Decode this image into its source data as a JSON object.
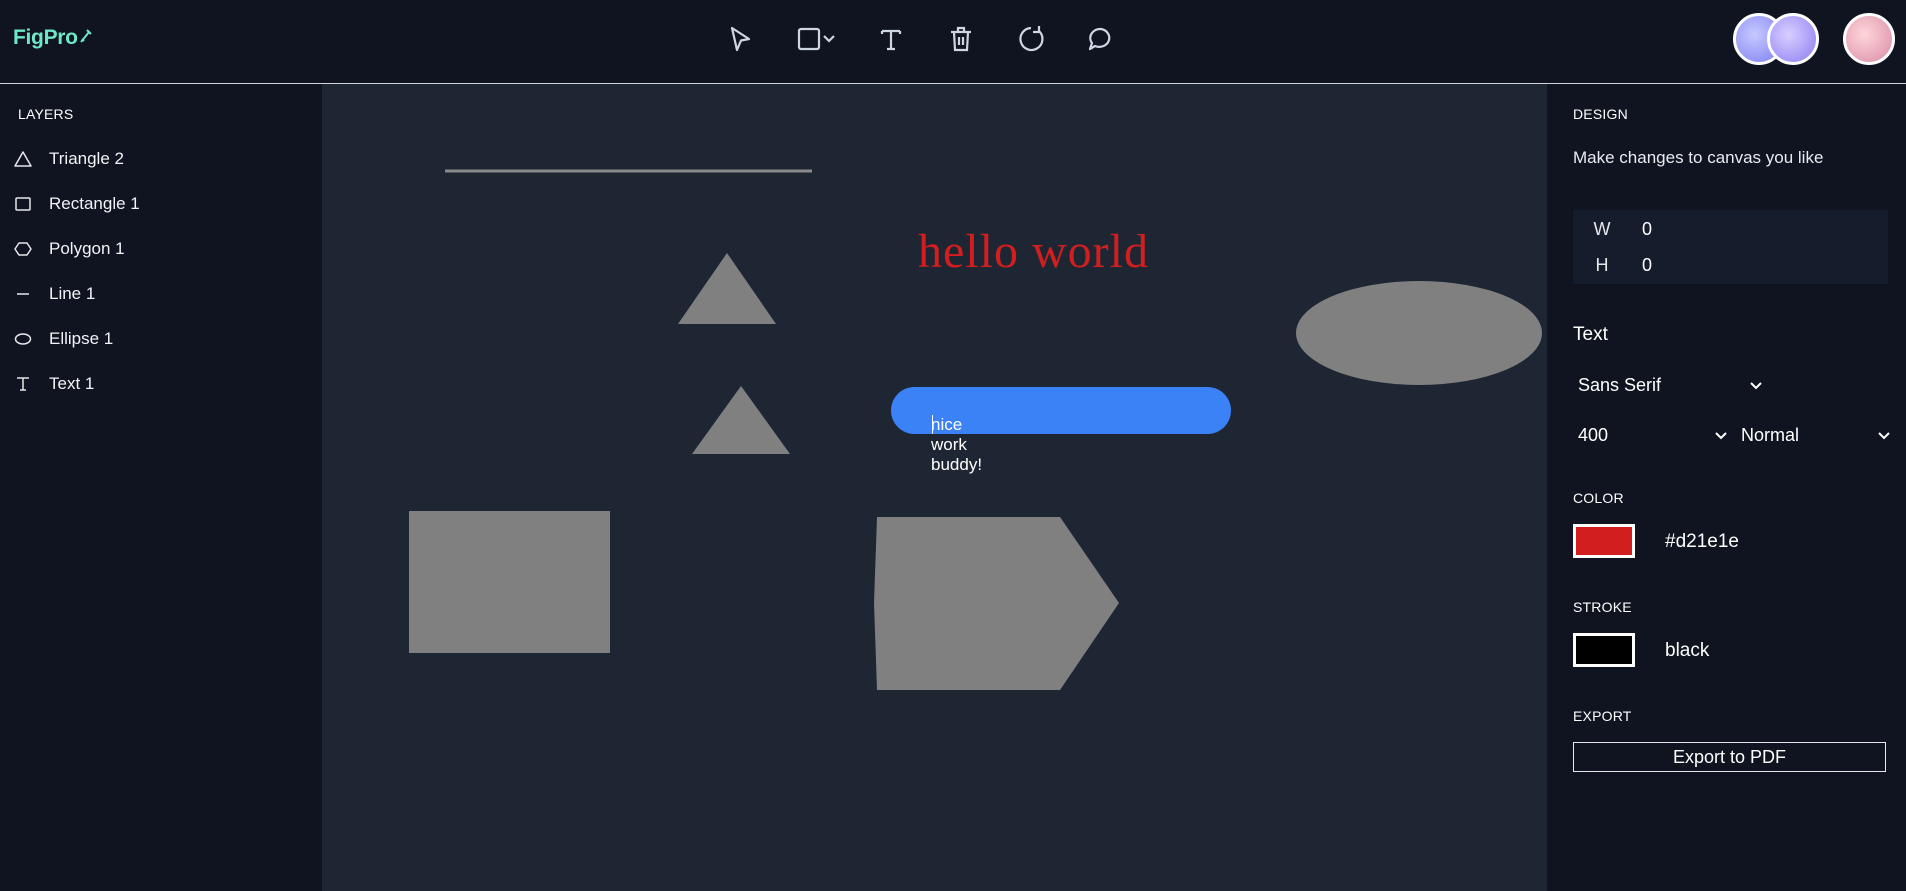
{
  "app": {
    "logo_text": "FigPro"
  },
  "toolbar": {
    "tools": [
      {
        "name": "select-tool",
        "icon": "cursor-arrow-icon"
      },
      {
        "name": "shape-tool",
        "icon": "square-icon"
      },
      {
        "name": "text-tool",
        "icon": "text-t-icon"
      },
      {
        "name": "delete-tool",
        "icon": "trash-icon"
      },
      {
        "name": "reset-tool",
        "icon": "rotate-icon"
      },
      {
        "name": "comment-tool",
        "icon": "speech-bubble-icon"
      }
    ]
  },
  "layers": {
    "title": "LAYERS",
    "items": [
      {
        "label": "Triangle 2",
        "icon": "triangle-icon"
      },
      {
        "label": "Rectangle 1",
        "icon": "rectangle-icon"
      },
      {
        "label": "Polygon 1",
        "icon": "hexagon-icon"
      },
      {
        "label": "Line 1",
        "icon": "line-icon"
      },
      {
        "label": "Ellipse 1",
        "icon": "ellipse-icon"
      },
      {
        "label": "Text 1",
        "icon": "text-t-icon"
      }
    ]
  },
  "canvas": {
    "heading_text": "hello world",
    "heading_color": "#d21e1e",
    "editing_text": "nice work  buddy!",
    "shape_color": "#808080",
    "background": "#1f2633"
  },
  "design": {
    "title": "DESIGN",
    "subtitle": "Make changes to canvas you like",
    "width_label": "W",
    "width_value": "0",
    "height_label": "H",
    "height_value": "0",
    "text_title": "Text",
    "font_family": "Sans Serif",
    "font_weight": "400",
    "font_style": "Normal",
    "color_title": "COLOR",
    "color_value": "#d21e1e",
    "stroke_title": "STROKE",
    "stroke_value": "black",
    "export_title": "EXPORT",
    "export_button": "Export to PDF"
  }
}
